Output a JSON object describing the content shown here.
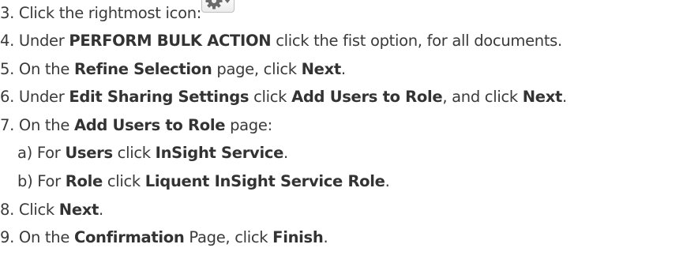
{
  "steps": [
    {
      "number": "3.",
      "parts": [
        "Click the rightmost icon:"
      ]
    },
    {
      "number": "4.",
      "parts": [
        "Under",
        "PERFORM BULK ACTION",
        "click the fist option, for all documents."
      ]
    },
    {
      "number": "5.",
      "parts": [
        "On the",
        "Refine Selection",
        "page, click",
        "Next",
        "."
      ]
    },
    {
      "number": "6.",
      "parts": [
        "Under",
        "Edit Sharing Settings",
        "click",
        "Add Users to Role",
        ", and click",
        "Next",
        "."
      ]
    },
    {
      "number": "7.",
      "parts": [
        "On the",
        "Add Users to Role",
        "page:"
      ]
    },
    {
      "number": "a)",
      "parts": [
        "For",
        "Users",
        "click",
        "InSight Service",
        "."
      ]
    },
    {
      "number": "b)",
      "parts": [
        "For",
        "Role",
        "click",
        "Liquent InSight Service Role",
        "."
      ]
    },
    {
      "number": "8.",
      "parts": [
        "Click",
        "Next",
        "."
      ]
    },
    {
      "number": "9.",
      "parts": [
        "On the",
        "Confirmation",
        "Page, click",
        "Finish",
        "."
      ]
    }
  ],
  "icons": {
    "settings_button": "gear-dropdown-icon",
    "icon_color": "#6b6b6b"
  }
}
